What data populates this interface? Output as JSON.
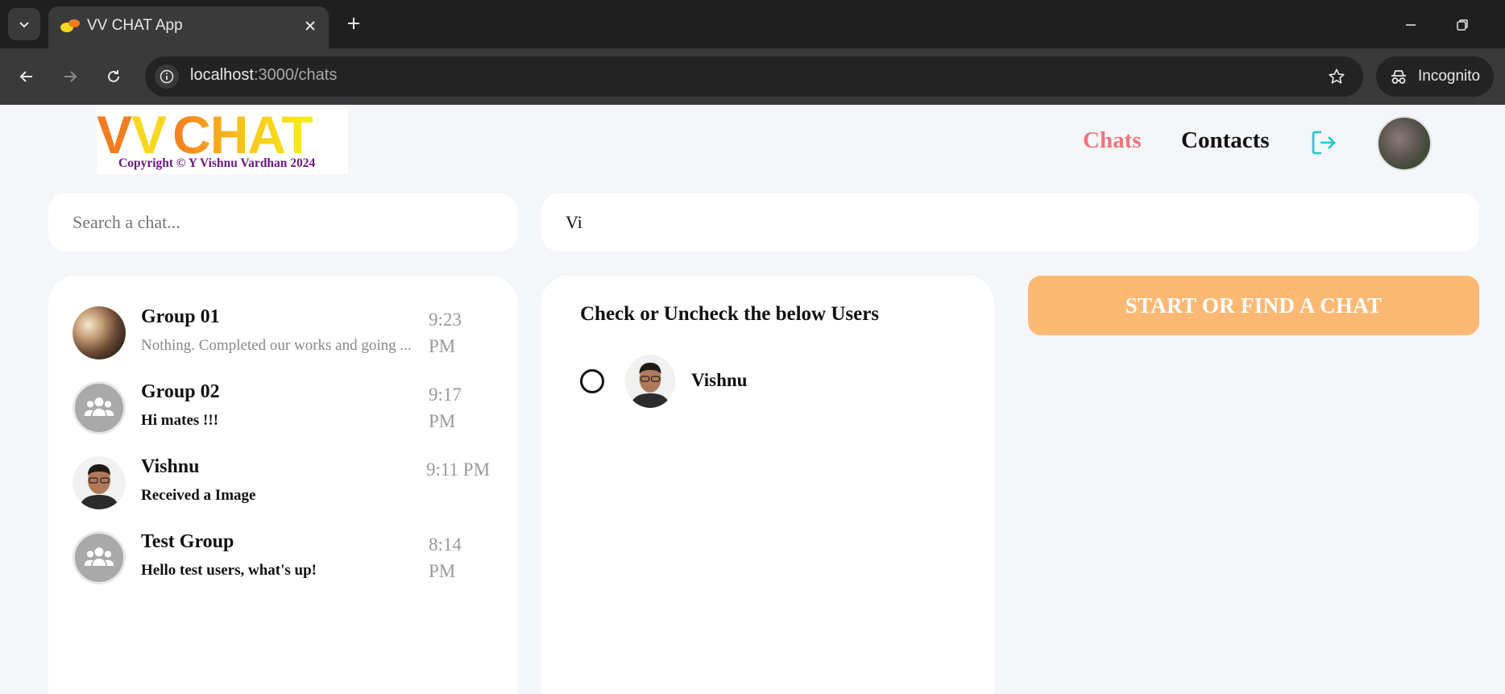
{
  "browser": {
    "tab_title": "VV CHAT App",
    "url_host": "localhost",
    "url_path": ":3000/chats",
    "incognito_label": "Incognito"
  },
  "app": {
    "logo": {
      "vv": "VV",
      "chat": "CHAT",
      "copyright": "Copyright © Y Vishnu Vardhan 2024"
    },
    "nav": {
      "chats": "Chats",
      "contacts": "Contacts"
    },
    "search_chat": {
      "placeholder": "Search a chat...",
      "value": ""
    },
    "search_users": {
      "value": "Vi"
    },
    "chats": [
      {
        "name": "Group 01",
        "message": "Nothing. Completed our works and going ...",
        "time": "9:23 PM",
        "unread": false,
        "avatar": "group-photo"
      },
      {
        "name": "Group 02",
        "message": "Hi mates !!!",
        "time": "9:17 PM",
        "unread": true,
        "avatar": "group-icon"
      },
      {
        "name": "Vishnu",
        "message": "Received a Image",
        "time": "9:11 PM",
        "unread": true,
        "avatar": "person-photo"
      },
      {
        "name": "Test Group",
        "message": "Hello test users, what's up!",
        "time": "8:14 PM",
        "unread": true,
        "avatar": "group-icon"
      }
    ],
    "users_panel": {
      "title": "Check or Uncheck the below Users",
      "users": [
        {
          "name": "Vishnu",
          "checked": false
        }
      ]
    },
    "start_button": "START OR FIND A CHAT"
  },
  "colors": {
    "chats_nav": "#f0757a",
    "start_button": "#fdb974",
    "logout_icon": "#1ec8d0"
  }
}
